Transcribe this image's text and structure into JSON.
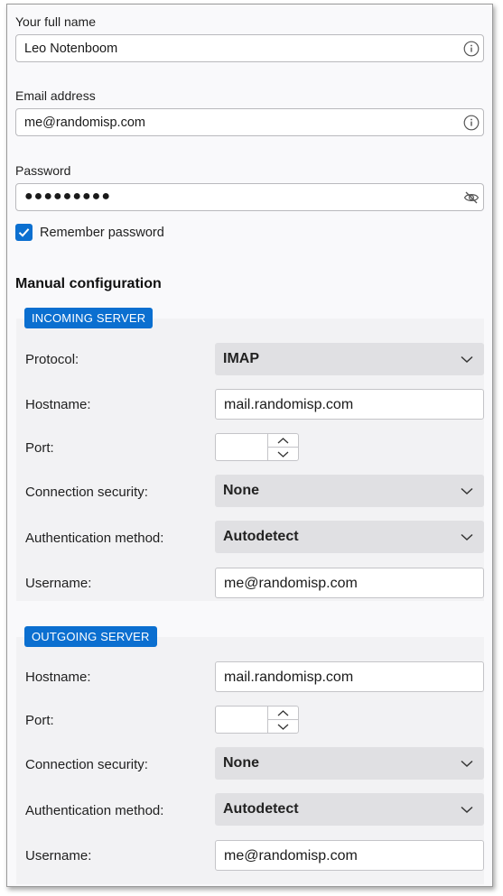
{
  "identity": {
    "name_label": "Your full name",
    "name_value": "Leo Notenboom",
    "email_label": "Email address",
    "email_value": "me@randomisp.com",
    "password_label": "Password",
    "password_mask": "●●●●●●●●●",
    "remember_label": "Remember password",
    "remember_checked": true
  },
  "manual": {
    "title": "Manual configuration",
    "incoming": {
      "tag": "INCOMING SERVER",
      "protocol_label": "Protocol:",
      "protocol_value": "IMAP",
      "hostname_label": "Hostname:",
      "hostname_value": "mail.randomisp.com",
      "port_label": "Port:",
      "port_value": "",
      "security_label": "Connection security:",
      "security_value": "None",
      "auth_label": "Authentication method:",
      "auth_value": "Autodetect",
      "username_label": "Username:",
      "username_value": "me@randomisp.com"
    },
    "outgoing": {
      "tag": "OUTGOING SERVER",
      "hostname_label": "Hostname:",
      "hostname_value": "mail.randomisp.com",
      "port_label": "Port:",
      "port_value": "",
      "security_label": "Connection security:",
      "security_value": "None",
      "auth_label": "Authentication method:",
      "auth_value": "Autodetect",
      "username_label": "Username:",
      "username_value": "me@randomisp.com"
    }
  },
  "colors": {
    "accent": "#0b6fd0",
    "select_bg": "#e0e0e3",
    "panel_bg": "#f2f2f4"
  },
  "icons": {
    "info": "info-icon",
    "password_toggle": "eye-slash-icon",
    "dropdown": "chevron-down-icon",
    "spin_up": "chevron-up-icon",
    "spin_down": "chevron-down-icon",
    "check": "checkmark-icon"
  }
}
